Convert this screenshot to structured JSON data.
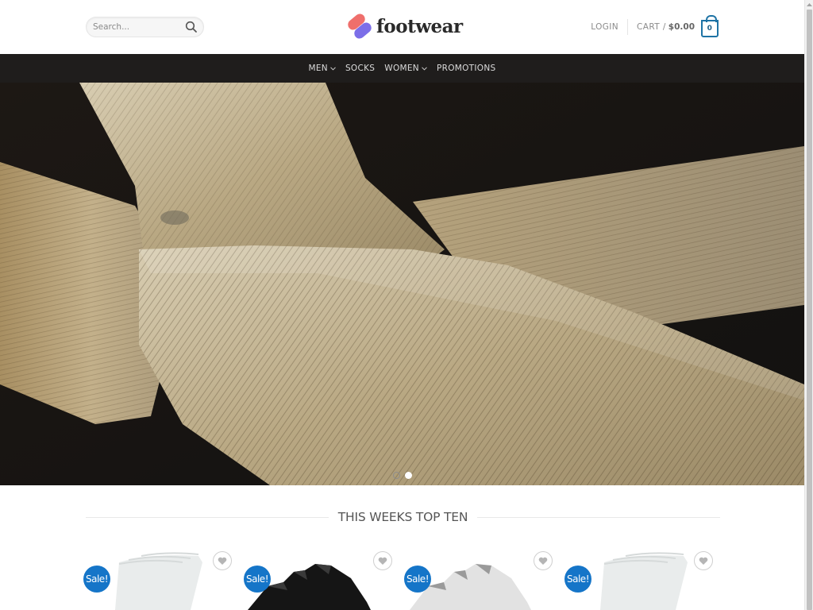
{
  "header": {
    "search": {
      "placeholder": "Search...",
      "value": "",
      "icon": "search-icon"
    },
    "logo": {
      "text": "footwear",
      "icon": "footwear-logo-icon",
      "colors": {
        "primary": "#ef6f6c",
        "secondary": "#7b6ee8"
      }
    },
    "login_label": "LOGIN",
    "cart": {
      "label": "CART /",
      "total": "$0.00",
      "count": "0",
      "icon": "cart-bag-icon",
      "accent": "#1e73a5"
    }
  },
  "nav": {
    "items": [
      {
        "label": "MEN",
        "has_dropdown": true
      },
      {
        "label": "SOCKS",
        "has_dropdown": false
      },
      {
        "label": "WOMEN",
        "has_dropdown": true
      },
      {
        "label": "PROMOTIONS",
        "has_dropdown": false
      }
    ]
  },
  "hero": {
    "description": "Close-up of beige ribbed socks on dark background",
    "slides": 2,
    "active_slide": 2
  },
  "section": {
    "title": "THIS WEEKS TOP TEN"
  },
  "products": [
    {
      "badge": "Sale!",
      "image": "white crew socks",
      "wishlist_icon": "heart-icon"
    },
    {
      "badge": "Sale!",
      "image": "black ankle socks",
      "wishlist_icon": "heart-icon"
    },
    {
      "badge": "Sale!",
      "image": "white ankle socks",
      "wishlist_icon": "heart-icon"
    },
    {
      "badge": "Sale!",
      "image": "white crew socks",
      "wishlist_icon": "heart-icon"
    }
  ],
  "colors": {
    "sale_badge": "#1575c8",
    "navbar_bg": "#1f1d1c"
  }
}
